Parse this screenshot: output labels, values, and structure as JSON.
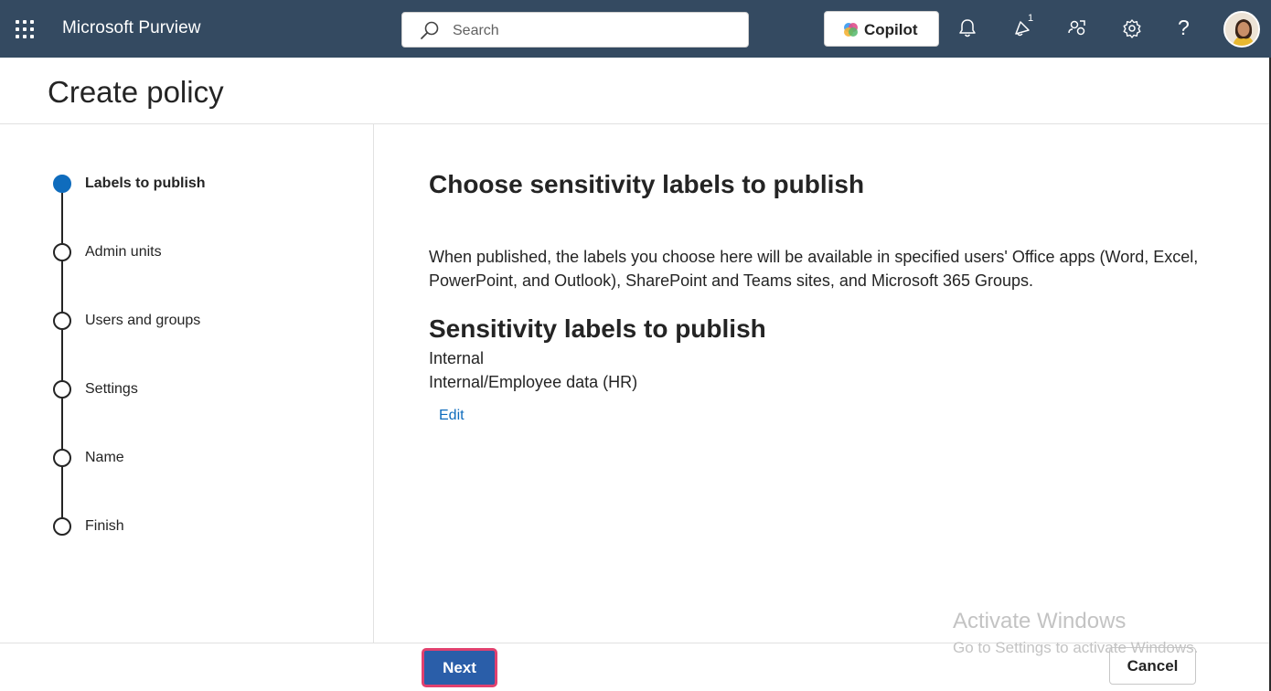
{
  "topbar": {
    "app_title": "Microsoft Purview",
    "search_placeholder": "Search",
    "copilot_label": "Copilot",
    "notification_badge": "1",
    "help_glyph": "?",
    "icons": [
      "app-launcher-icon",
      "search-icon",
      "copilot-icon",
      "bell-icon",
      "whats-new-icon",
      "feedback-icon",
      "gear-icon",
      "help-icon",
      "avatar"
    ],
    "background_color": "#344a61"
  },
  "header": {
    "title": "Create policy"
  },
  "steps": [
    {
      "label": "Labels to publish",
      "active": true
    },
    {
      "label": "Admin units",
      "active": false
    },
    {
      "label": "Users and groups",
      "active": false
    },
    {
      "label": "Settings",
      "active": false
    },
    {
      "label": "Name",
      "active": false
    },
    {
      "label": "Finish",
      "active": false
    }
  ],
  "main": {
    "heading": "Choose sensitivity labels to publish",
    "description": "When published, the labels you choose here will be available in specified users' Office apps (Word, Excel, PowerPoint, and Outlook), SharePoint and Teams sites, and Microsoft 365 Groups.",
    "subheading": "Sensitivity labels to publish",
    "labels": [
      "Internal",
      "Internal/Employee data (HR)"
    ],
    "edit_link": "Edit"
  },
  "footer": {
    "next_label": "Next",
    "cancel_label": "Cancel",
    "accent_color": "#2a5ea9",
    "highlight_color": "#e1416f"
  },
  "watermark": {
    "title": "Activate Windows",
    "subtitle": "Go to Settings to activate Windows."
  }
}
